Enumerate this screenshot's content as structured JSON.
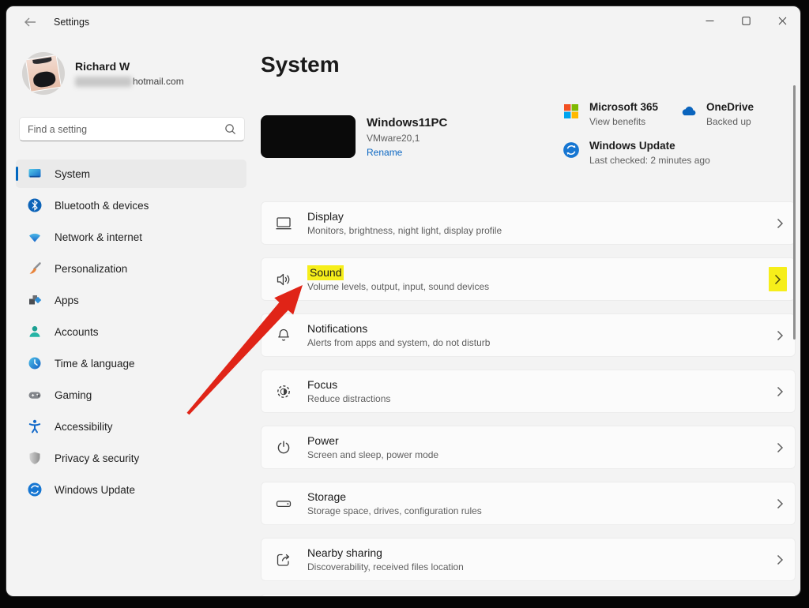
{
  "titlebar": {
    "title": "Settings",
    "back_icon": "back-arrow",
    "minimize_glyph": "–",
    "maximize_glyph": "▢",
    "close_glyph": "✕"
  },
  "profile": {
    "name": "Richard W",
    "email_visible": "hotmail.com",
    "email_redacted": true
  },
  "search": {
    "placeholder": "Find a setting",
    "icon": "search-icon"
  },
  "sidebar": {
    "selected": "System",
    "items": [
      {
        "label": "System",
        "icon": "system-icon"
      },
      {
        "label": "Bluetooth & devices",
        "icon": "bluetooth-icon"
      },
      {
        "label": "Network & internet",
        "icon": "network-icon"
      },
      {
        "label": "Personalization",
        "icon": "personalization-icon"
      },
      {
        "label": "Apps",
        "icon": "apps-icon"
      },
      {
        "label": "Accounts",
        "icon": "accounts-icon"
      },
      {
        "label": "Time & language",
        "icon": "time-language-icon"
      },
      {
        "label": "Gaming",
        "icon": "gaming-icon"
      },
      {
        "label": "Accessibility",
        "icon": "accessibility-icon"
      },
      {
        "label": "Privacy & security",
        "icon": "privacy-security-icon"
      },
      {
        "label": "Windows Update",
        "icon": "windows-update-icon"
      }
    ]
  },
  "main": {
    "title": "System",
    "device": {
      "name": "Windows11PC",
      "model": "VMware20,1",
      "rename_label": "Rename",
      "thumbnail": "redacted-black"
    },
    "status_tiles": [
      {
        "title": "Microsoft 365",
        "subtitle": "View benefits",
        "icon": "microsoft-365-icon"
      },
      {
        "title": "OneDrive",
        "subtitle": "Backed up",
        "icon": "onedrive-icon"
      },
      {
        "title": "Windows Update",
        "subtitle": "Last checked: 2 minutes ago",
        "icon": "windows-update-icon"
      }
    ],
    "cards": [
      {
        "title": "Display",
        "subtitle": "Monitors, brightness, night light, display profile",
        "icon": "display-icon",
        "highlighted": false
      },
      {
        "title": "Sound",
        "subtitle": "Volume levels, output, input, sound devices",
        "icon": "sound-icon",
        "highlighted": true
      },
      {
        "title": "Notifications",
        "subtitle": "Alerts from apps and system, do not disturb",
        "icon": "notifications-icon",
        "highlighted": false
      },
      {
        "title": "Focus",
        "subtitle": "Reduce distractions",
        "icon": "focus-icon",
        "highlighted": false
      },
      {
        "title": "Power",
        "subtitle": "Screen and sleep, power mode",
        "icon": "power-icon",
        "highlighted": false
      },
      {
        "title": "Storage",
        "subtitle": "Storage space, drives, configuration rules",
        "icon": "storage-icon",
        "highlighted": false
      },
      {
        "title": "Nearby sharing",
        "subtitle": "Discoverability, received files location",
        "icon": "nearby-sharing-icon",
        "highlighted": false
      }
    ]
  },
  "annotations": {
    "arrow_color": "#e02417",
    "highlight_color": "#f6ee1a",
    "arrow_points_to": "Sound"
  },
  "colors": {
    "window_bg": "#f3f3f3",
    "card_bg": "#fbfbfb",
    "accent_blue": "#0067c0",
    "link_blue": "#0a66c2",
    "text_primary": "#1b1b1b",
    "text_secondary": "#5f5f5f"
  }
}
